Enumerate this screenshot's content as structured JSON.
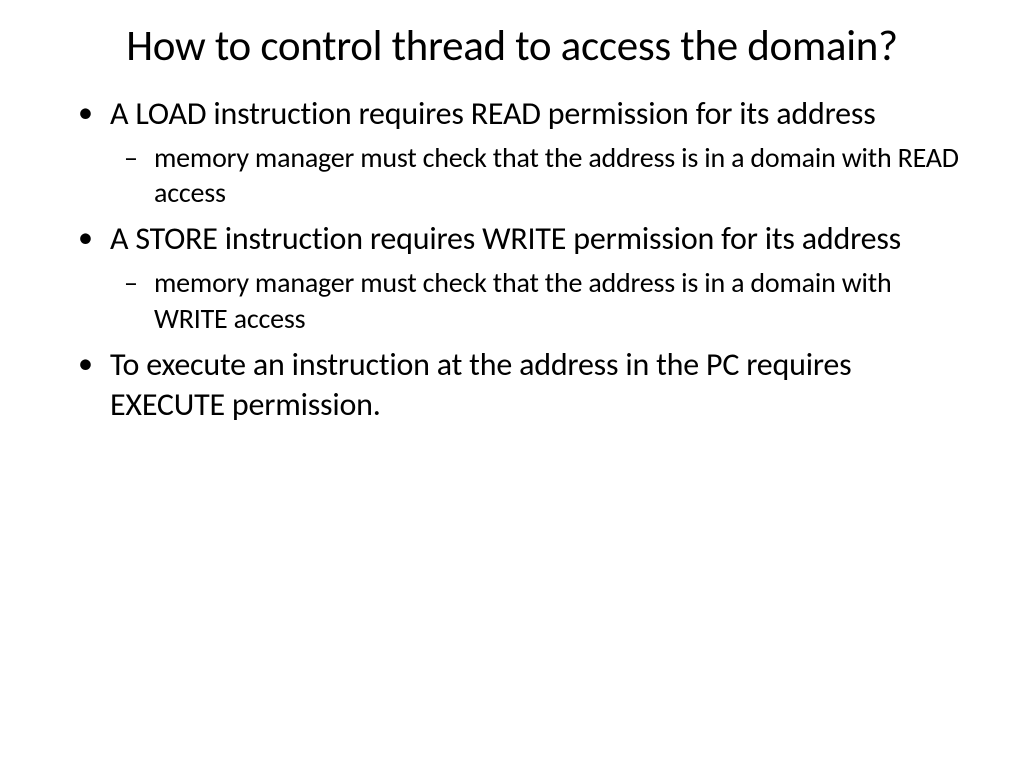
{
  "title": "How to control thread to access the domain?",
  "bullets": [
    {
      "text": "A LOAD instruction requires READ permission for its address",
      "sub": [
        "memory manager must check that the address is in a domain with READ access"
      ]
    },
    {
      "text": "A STORE instruction requires WRITE permission for its address",
      "sub": [
        "memory manager must check that the address is in a domain with WRITE access"
      ]
    },
    {
      "text": "To execute an instruction at the address in the PC requires EXECUTE permission.",
      "sub": []
    }
  ]
}
